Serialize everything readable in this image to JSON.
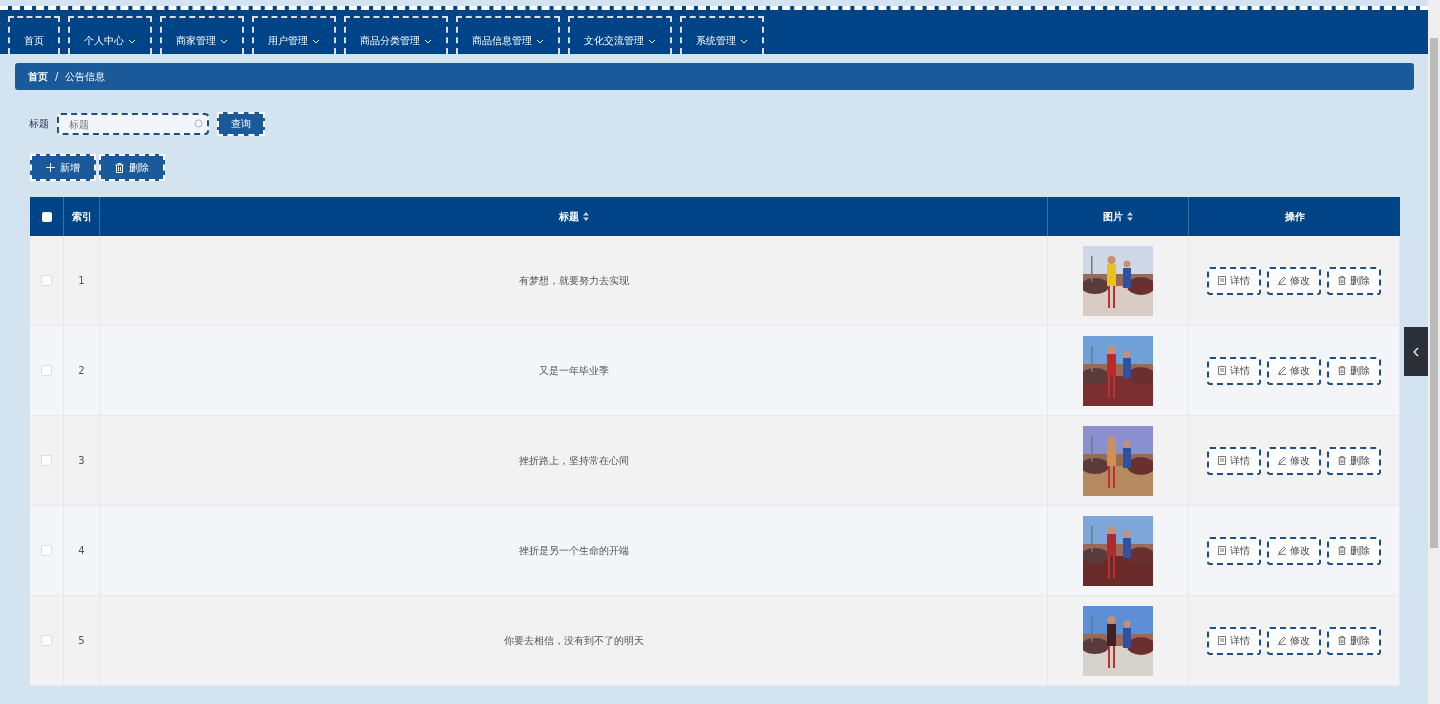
{
  "nav": [
    {
      "label": "首页",
      "dropdown": false
    },
    {
      "label": "个人中心",
      "dropdown": true
    },
    {
      "label": "商家管理",
      "dropdown": true
    },
    {
      "label": "用户管理",
      "dropdown": true
    },
    {
      "label": "商品分类管理",
      "dropdown": true
    },
    {
      "label": "商品信息管理",
      "dropdown": true
    },
    {
      "label": "文化交流管理",
      "dropdown": true
    },
    {
      "label": "系统管理",
      "dropdown": true
    }
  ],
  "breadcrumb": {
    "items": [
      "首页",
      "公告信息"
    ],
    "separator": "/"
  },
  "search": {
    "label": "标题",
    "placeholder": "标题",
    "button": "查询"
  },
  "actions": [
    {
      "kind": "add",
      "label": "新增"
    },
    {
      "kind": "delete",
      "label": "删除"
    }
  ],
  "table": {
    "columns": [
      {
        "kind": "check",
        "checked": false
      },
      {
        "kind": "text",
        "label": "索引",
        "sortable": false
      },
      {
        "kind": "text",
        "label": "标题",
        "sortable": true
      },
      {
        "kind": "text",
        "label": "图片",
        "sortable": true
      },
      {
        "kind": "text",
        "label": "操作",
        "sortable": false
      }
    ],
    "rows": [
      {
        "selected": false,
        "index": "1",
        "title": "有梦想，就要努力去实现",
        "buttons": [
          {
            "kind": "detail",
            "label": "详情"
          },
          {
            "kind": "edit",
            "label": "修改"
          },
          {
            "kind": "delete",
            "label": "删除"
          }
        ]
      },
      {
        "selected": false,
        "index": "2",
        "title": "又是一年毕业季",
        "buttons": [
          {
            "kind": "detail",
            "label": "详情"
          },
          {
            "kind": "edit",
            "label": "修改"
          },
          {
            "kind": "delete",
            "label": "删除"
          }
        ]
      },
      {
        "selected": false,
        "index": "3",
        "title": "挫折路上，坚持常在心间",
        "buttons": [
          {
            "kind": "detail",
            "label": "详情"
          },
          {
            "kind": "edit",
            "label": "修改"
          },
          {
            "kind": "delete",
            "label": "删除"
          }
        ]
      },
      {
        "selected": false,
        "index": "4",
        "title": "挫折是另一个生命的开端",
        "buttons": [
          {
            "kind": "detail",
            "label": "详情"
          },
          {
            "kind": "edit",
            "label": "修改"
          },
          {
            "kind": "delete",
            "label": "删除"
          }
        ]
      },
      {
        "selected": false,
        "index": "5",
        "title": "你要去相信，没有到不了的明天",
        "buttons": [
          {
            "kind": "detail",
            "label": "详情"
          },
          {
            "kind": "edit",
            "label": "修改"
          },
          {
            "kind": "delete",
            "label": "删除"
          }
        ]
      }
    ]
  }
}
